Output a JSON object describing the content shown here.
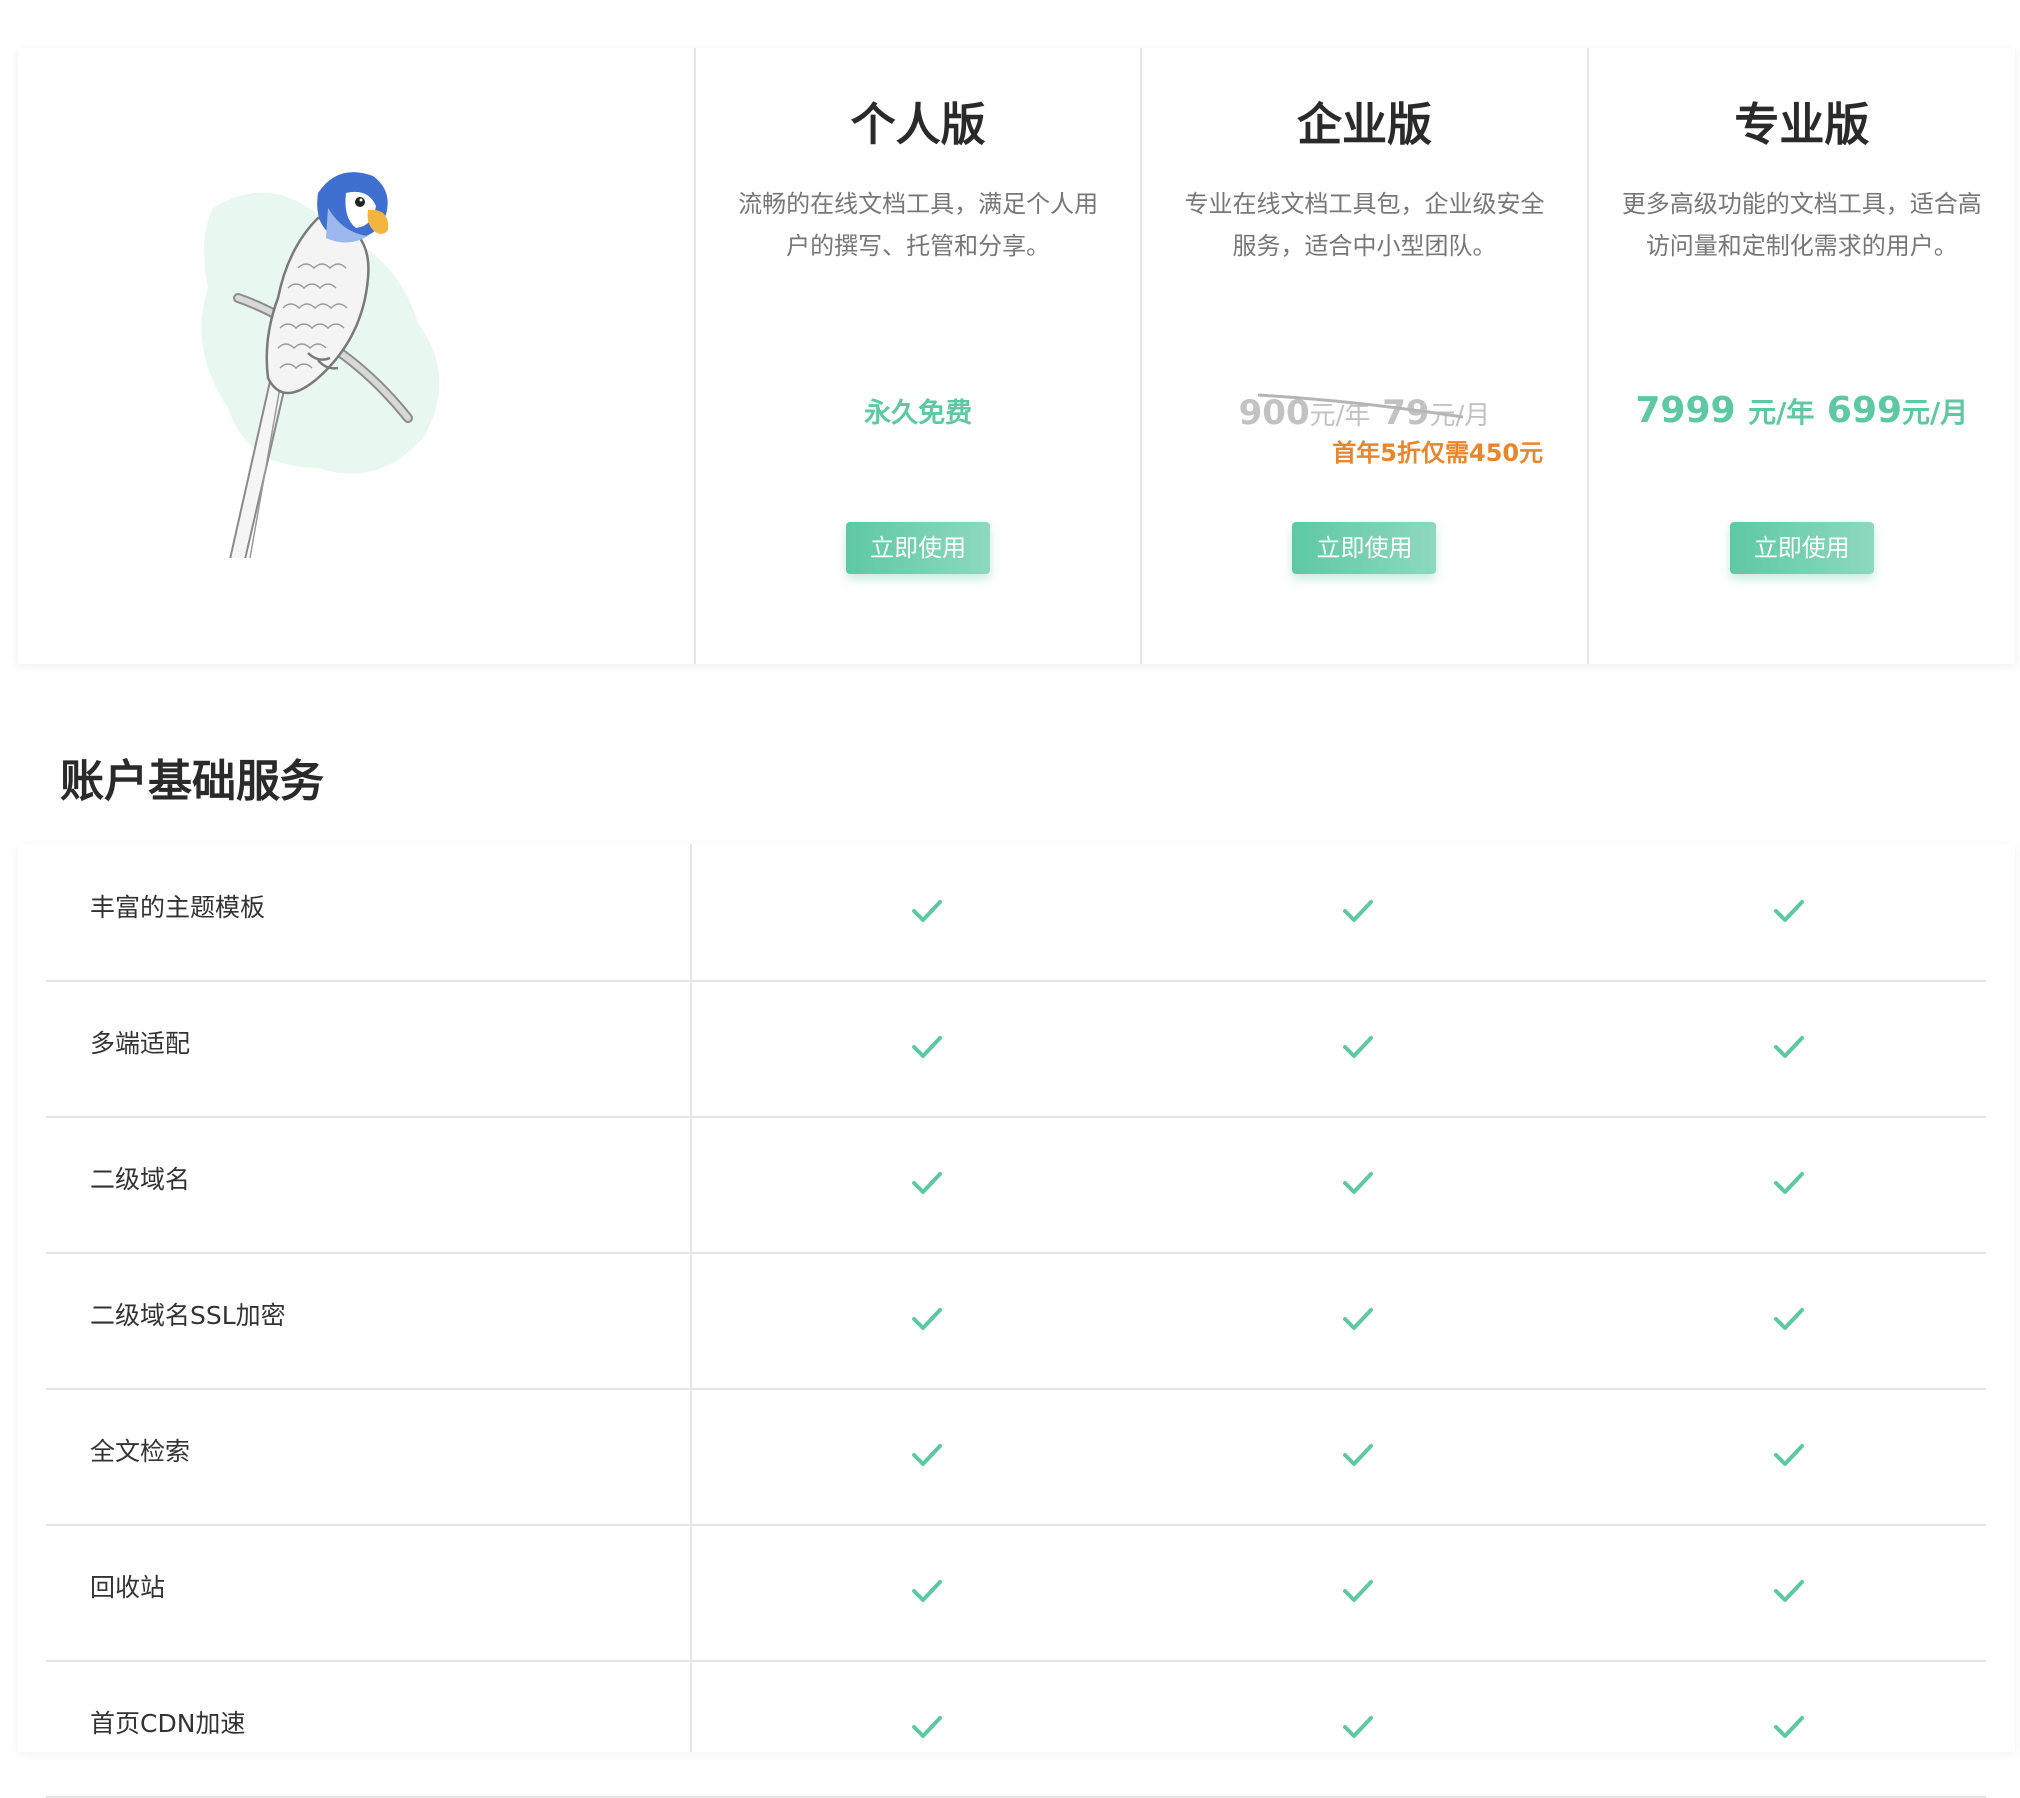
{
  "plans": [
    {
      "title": "个人版",
      "desc_line1": "流畅的在线文档工具，满足个人用",
      "desc_line2": "户的撰写、托管和分享。",
      "price": "永久免费",
      "button": "立即使用"
    },
    {
      "title": "企业版",
      "desc_line1": "专业在线文档工具包，企业级安全",
      "desc_line2": "服务，适合中小型团队。",
      "price_year_num": "900",
      "price_year_unit": "元/年",
      "price_month_num": "79",
      "price_month_unit": "元/月",
      "promo": "首年5折仅需450元",
      "button": "立即使用"
    },
    {
      "title": "专业版",
      "desc_line1": "更多高级功能的文档工具，适合高",
      "desc_line2": "访问量和定制化需求的用户。",
      "price_year_num": "7999",
      "price_year_unit": "元/年",
      "price_month_num": "699",
      "price_month_unit": "元/月",
      "button": "立即使用"
    }
  ],
  "section": {
    "title": "账户基础服务"
  },
  "features": [
    {
      "label": "丰富的主题模板",
      "personal": true,
      "enterprise": true,
      "pro": true
    },
    {
      "label": "多端适配",
      "personal": true,
      "enterprise": true,
      "pro": true
    },
    {
      "label": "二级域名",
      "personal": true,
      "enterprise": true,
      "pro": true
    },
    {
      "label": "二级域名SSL加密",
      "personal": true,
      "enterprise": true,
      "pro": true
    },
    {
      "label": "全文检索",
      "personal": true,
      "enterprise": true,
      "pro": true
    },
    {
      "label": "回收站",
      "personal": true,
      "enterprise": true,
      "pro": true
    },
    {
      "label": "首页CDN加速",
      "personal": true,
      "enterprise": true,
      "pro": true
    }
  ],
  "colors": {
    "accent": "#5ec8a4",
    "promo": "#e8862c",
    "muted": "#c2c2c2"
  },
  "icons": {
    "check": "check-icon",
    "hero": "parrot-illustration"
  }
}
